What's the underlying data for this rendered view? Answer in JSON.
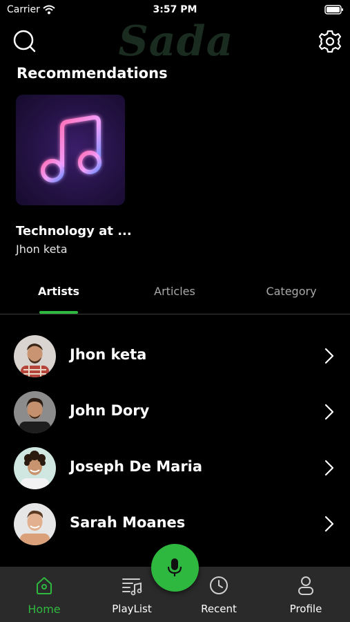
{
  "status_bar": {
    "carrier": "Carrier",
    "time": "3:57 PM"
  },
  "header": {
    "logo": "Sada",
    "search_icon": "search-icon",
    "settings_icon": "gear-icon"
  },
  "recommendations": {
    "title": "Recommendations",
    "items": [
      {
        "title": "Technology at ...",
        "artist": "Jhon keta",
        "art_icon": "music-note-icon"
      }
    ]
  },
  "tabs": [
    {
      "label": "Artists",
      "active": true
    },
    {
      "label": "Articles",
      "active": false
    },
    {
      "label": "Category",
      "active": false
    }
  ],
  "artists": [
    {
      "name": "Jhon keta"
    },
    {
      "name": "John Dory"
    },
    {
      "name": "Joseph De Maria"
    },
    {
      "name": "Sarah Moanes"
    }
  ],
  "bottom_nav": {
    "items": [
      {
        "label": "Home",
        "icon": "home-icon",
        "active": true
      },
      {
        "label": "PlayList",
        "icon": "playlist-icon",
        "active": false
      },
      {
        "label": "Recent",
        "icon": "clock-icon",
        "active": false
      },
      {
        "label": "Profile",
        "icon": "user-icon",
        "active": false
      }
    ],
    "center_button_icon": "microphone-icon"
  },
  "colors": {
    "accent": "#2fb83f",
    "background": "#000000",
    "tab_bar": "#2a2a2a"
  }
}
